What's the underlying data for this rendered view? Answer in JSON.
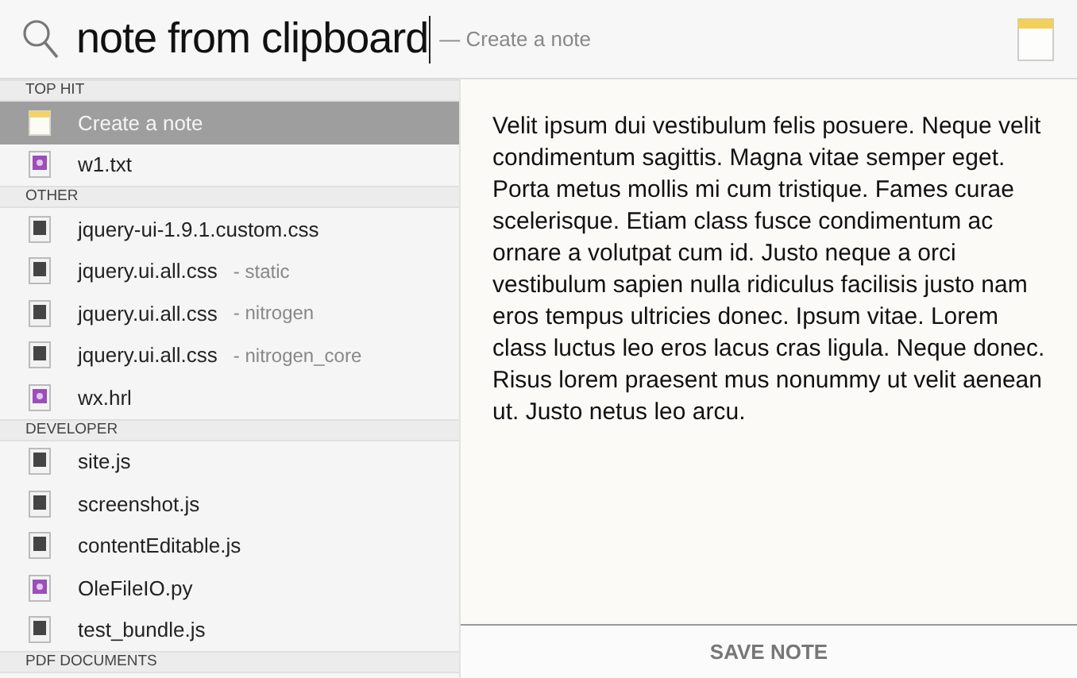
{
  "search": {
    "query": "note from clipboard",
    "hint": "— Create a note"
  },
  "sections": [
    {
      "title": "TOP HIT",
      "items": [
        {
          "kind": "note",
          "label": "Create a note",
          "selected": true
        },
        {
          "kind": "purple",
          "label": "w1.txt",
          "selected": false
        }
      ]
    },
    {
      "title": "OTHER",
      "items": [
        {
          "kind": "doc",
          "label": "jquery-ui-1.9.1.custom.css",
          "selected": false
        },
        {
          "kind": "doc",
          "label": "jquery.ui.all.css",
          "detail": "- static",
          "selected": false
        },
        {
          "kind": "doc",
          "label": "jquery.ui.all.css",
          "detail": "- nitrogen",
          "selected": false
        },
        {
          "kind": "doc",
          "label": "jquery.ui.all.css",
          "detail": "- nitrogen_core",
          "selected": false
        },
        {
          "kind": "purple",
          "label": "wx.hrl",
          "selected": false
        }
      ]
    },
    {
      "title": "DEVELOPER",
      "items": [
        {
          "kind": "doc",
          "label": "site.js",
          "selected": false
        },
        {
          "kind": "doc",
          "label": "screenshot.js",
          "selected": false
        },
        {
          "kind": "doc",
          "label": "contentEditable.js",
          "selected": false
        },
        {
          "kind": "purple",
          "label": "OleFileIO.py",
          "selected": false
        },
        {
          "kind": "doc",
          "label": "test_bundle.js",
          "selected": false
        }
      ]
    },
    {
      "title": "PDF DOCUMENTS"
    }
  ],
  "preview": {
    "text": "Velit ipsum dui vestibulum felis posuere. Neque velit condimentum sagittis. Magna vitae semper eget. Porta metus mollis mi cum tristique. Fames curae scelerisque. Etiam class fusce condimentum ac ornare a volutpat cum id. Justo neque a orci vestibulum sapien nulla ridiculus facilisis justo nam eros tempus ultricies donec. Ipsum vitae. Lorem class luctus leo eros lacus cras ligula. Neque donec. Risus lorem praesent mus nonummy ut velit aenean ut. Justo netus leo arcu.",
    "button": "SAVE NOTE"
  }
}
